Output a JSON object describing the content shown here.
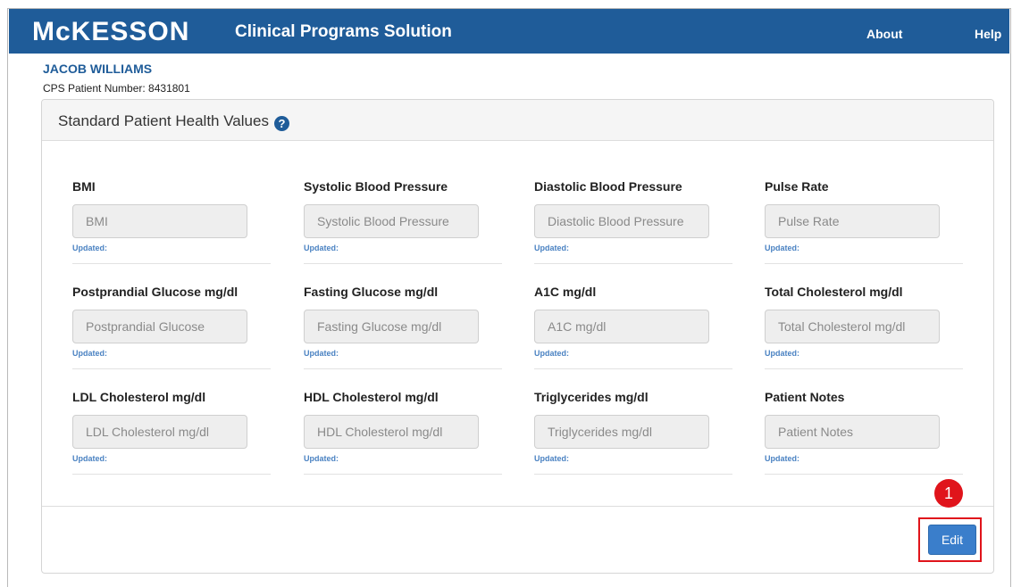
{
  "header": {
    "logo_text": "McKESSON",
    "app_title": "Clinical Programs Solution",
    "nav": {
      "about": "About",
      "help": "Help"
    }
  },
  "patient": {
    "name": "JACOB WILLIAMS",
    "number_label": "CPS Patient Number: 8431801"
  },
  "panel": {
    "title": "Standard Patient Health Values",
    "help_icon": "question-circle-icon",
    "fields": [
      {
        "label": "BMI",
        "placeholder": "BMI",
        "updated": "Updated:"
      },
      {
        "label": "Systolic Blood Pressure",
        "placeholder": "Systolic Blood Pressure",
        "updated": "Updated:"
      },
      {
        "label": "Diastolic Blood Pressure",
        "placeholder": "Diastolic Blood Pressure",
        "updated": "Updated:"
      },
      {
        "label": "Pulse Rate",
        "placeholder": "Pulse Rate",
        "updated": "Updated:"
      },
      {
        "label": "Postprandial Glucose mg/dl",
        "placeholder": "Postprandial Glucose",
        "updated": "Updated:"
      },
      {
        "label": "Fasting Glucose mg/dl",
        "placeholder": "Fasting Glucose mg/dl",
        "updated": "Updated:"
      },
      {
        "label": "A1C mg/dl",
        "placeholder": "A1C mg/dl",
        "updated": "Updated:"
      },
      {
        "label": "Total Cholesterol mg/dl",
        "placeholder": "Total Cholesterol mg/dl",
        "updated": "Updated:"
      },
      {
        "label": "LDL Cholesterol mg/dl",
        "placeholder": "LDL Cholesterol mg/dl",
        "updated": "Updated:"
      },
      {
        "label": "HDL Cholesterol mg/dl",
        "placeholder": "HDL Cholesterol mg/dl",
        "updated": "Updated:"
      },
      {
        "label": "Triglycerides mg/dl",
        "placeholder": "Triglycerides mg/dl",
        "updated": "Updated:"
      },
      {
        "label": "Patient Notes",
        "placeholder": "Patient Notes",
        "updated": "Updated:"
      }
    ],
    "edit_label": "Edit"
  },
  "annotation": {
    "step_number": "1",
    "color": "#e0141b"
  },
  "colors": {
    "brand": "#1f5c99",
    "button": "#3a7ecb"
  }
}
